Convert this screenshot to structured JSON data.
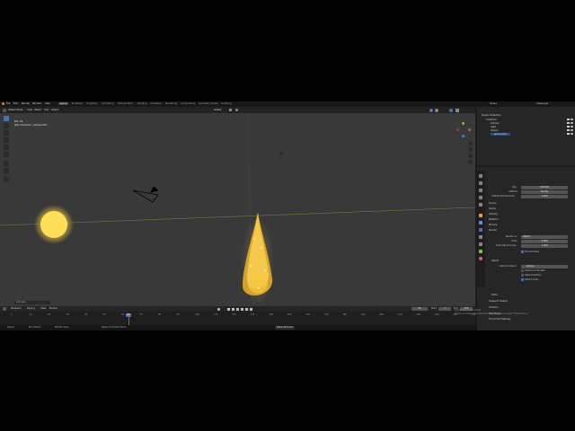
{
  "menubar": {
    "items": [
      "File",
      "Edit",
      "Render",
      "Window",
      "Help"
    ],
    "workspaces": [
      "Layout",
      "Modeling",
      "Sculpting",
      "UV Editing",
      "Texture Paint",
      "Shading",
      "Animation",
      "Rendering",
      "Compositing",
      "Geometry Nodes",
      "Scripting"
    ],
    "scene": "Scene",
    "view_layer": "ViewLayer"
  },
  "viewport": {
    "mode": "Object Mode",
    "menus": [
      "View",
      "Select",
      "Add",
      "Object"
    ],
    "orientation": "Global",
    "info_line1": "Bot. 24",
    "info_line2": "(64) Collection | Sphere.001",
    "hint": "Animate"
  },
  "outliner": {
    "title": "Scene Collection",
    "rows": [
      "Collection",
      "Camera",
      "Light",
      "Sphere",
      "Sphere.001"
    ]
  },
  "properties": {
    "top_fields": [
      {
        "label": "Size",
        "value": "100.000"
      },
      {
        "label": "Lifetime",
        "value": "50.000"
      },
      {
        "label": "Lifetime Randomness",
        "value": "0.000"
      }
    ],
    "panels": [
      "Source",
      "Cache",
      "Velocity",
      "Rotation",
      "Physics",
      "Render"
    ],
    "render_as_label": "Render As",
    "render_as_value": "Object",
    "scale_label": "Scale",
    "scale_value": "0.050",
    "scale_rand_label": "Scale Randomness",
    "scale_rand_value": "1.000",
    "show_emitter": "Show Emitter",
    "object_panel": "Object",
    "instance_object_label": "Instance Object",
    "instance_object_value": "Sphere",
    "checks": [
      "Global Coordinates",
      "Object Rotation",
      "Object Scale"
    ],
    "extra_panels": [
      "Extra",
      "Viewport Display",
      "Children",
      "Hair Shape",
      "Force Field Settings"
    ]
  },
  "timeline": {
    "menus": [
      "Playback",
      "Keying",
      "View",
      "Marker"
    ],
    "current_frame": "64",
    "start_label": "Start",
    "start": "1",
    "end_label": "End",
    "end": "250",
    "frames": [
      "0",
      "10",
      "20",
      "30",
      "40",
      "50",
      "60",
      "70",
      "80",
      "90",
      "100",
      "110",
      "120",
      "130",
      "140",
      "150",
      "160",
      "170",
      "180",
      "190",
      "200",
      "210",
      "220",
      "230",
      "240",
      "250"
    ]
  },
  "statusbar": {
    "left": [
      "Select",
      "Box Select",
      "Rotate View"
    ],
    "center": "Object Context Menu",
    "right": "Bake Particles"
  },
  "watermark": {
    "line1": "Активация Windows",
    "line2": "Чтобы активировать Windows, перейдите в раздел \"Параметры\"."
  },
  "colors": {
    "accent": "#4772b3",
    "glow": "#ffd34a",
    "viewport_bg": "#393939"
  }
}
